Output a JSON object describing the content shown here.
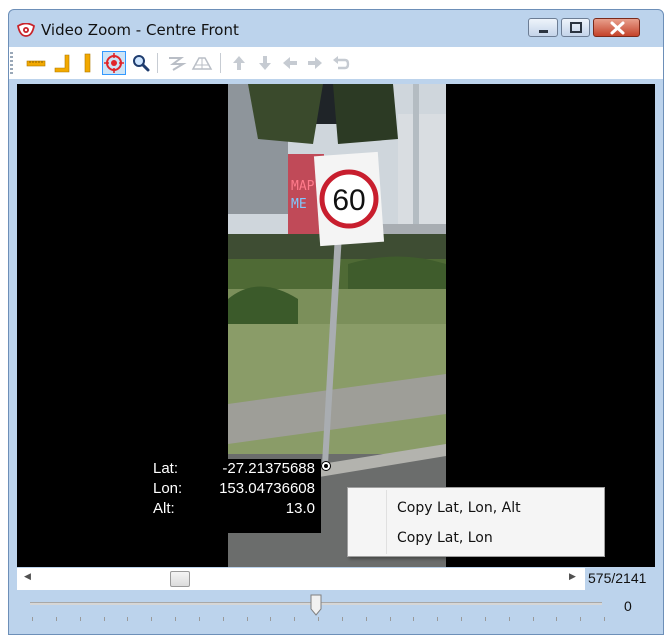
{
  "window": {
    "title": "Video Zoom - Centre Front",
    "app_icon": "eye-icon",
    "controls": [
      "minimize-icon",
      "maximize-icon",
      "close-icon"
    ]
  },
  "toolbar": {
    "tools": [
      {
        "icon": "horizontal-ruler-icon",
        "active": false
      },
      {
        "icon": "corner-ruler-icon",
        "active": false
      },
      {
        "icon": "vertical-ruler-icon",
        "active": false
      },
      {
        "icon": "crosshair-target-icon",
        "active": true
      },
      {
        "icon": "zoom-icon",
        "active": false
      },
      {
        "icon": "reshape-icon",
        "active": false
      },
      {
        "icon": "road-profile-icon",
        "active": false
      },
      {
        "icon": "arrow-up-icon",
        "active": false
      },
      {
        "icon": "arrow-down-icon",
        "active": false
      },
      {
        "icon": "arrow-left-icon",
        "active": false
      },
      {
        "icon": "arrow-right-icon",
        "active": false
      },
      {
        "icon": "undo-icon",
        "active": false
      }
    ]
  },
  "video": {
    "sign_speed": "60",
    "readout": {
      "lat_label": "Lat:",
      "lat_value": "-27.21375688",
      "lon_label": "Lon:",
      "lon_value": "153.04736608",
      "alt_label": "Alt:",
      "alt_value": "13.0"
    }
  },
  "context_menu": {
    "items": [
      {
        "label": "Copy Lat, Lon, Alt"
      },
      {
        "label": "Copy Lat, Lon"
      }
    ]
  },
  "playback": {
    "frame_counter": "575/2141",
    "frame_position": 0.268,
    "offset_value": "0",
    "offset_position": 0.5
  }
}
